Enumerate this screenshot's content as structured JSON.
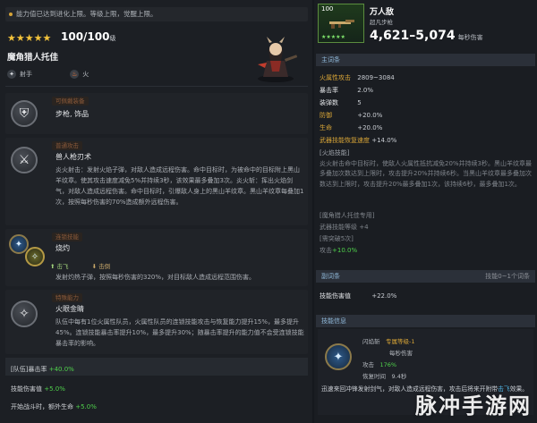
{
  "top_note": "能力值已达到进化上限。等级上限，觉醒上限。",
  "hero": {
    "stars": "★★★★★",
    "level": "100/100",
    "level_suffix": "级",
    "name": "魔角猎人托佳",
    "tags": [
      {
        "icon": "shooter-icon",
        "label": "射手"
      },
      {
        "icon": "fire-icon",
        "label": "火"
      }
    ]
  },
  "skills": [
    {
      "category": "可佩戴装备",
      "title": "步枪, 饰品",
      "text": ""
    },
    {
      "category": "普通攻击",
      "title": "兽人枪刃术",
      "text": "炎火射击：发射火焰子弹，对敌人造成远程伤害。命中目标时，为被命中的目标附上黑山羊纹章。使其攻击速度减免5%并持续3秒，该效果最多叠加3次。炎火斩：挥出火焰剑气，对敌人造成远程伤害。命中目标时，引爆敌人身上的黑山羊纹章。黑山羊纹章每叠加1次，按照每秒伤害的70%造成额外远程伤害。"
    },
    {
      "category": "连锁技能",
      "title": "烧灼",
      "text": "发射灼热子弹，按照每秒伤害的320%，对目标敌人造成远程范围伤害。",
      "sub_tags": [
        "击飞",
        "击倒"
      ]
    },
    {
      "category": "特殊能力",
      "title": "火眼金睛",
      "text": "队伍中每有1位火属性队员，火属性队员的连锁技能攻击与恢复能力提升15%，最多提升45%。连锁技能暴击率提升10%，最多提升30%；随暴击率提升的能力值不会受连锁技能暴击率的影响。"
    }
  ],
  "team": {
    "row1_label": "[队伍]暴击率",
    "row1_value": "+40.0%",
    "row2_label": "技能伤害值",
    "row2_value": "+5.0%",
    "row3_label": "开始战斗时，额外生命",
    "row3_value": "+5.0%"
  },
  "weapon": {
    "level": "100",
    "stars": "★★★★★",
    "name": "万人敌",
    "sub": "超凡步枪",
    "damage": "4,621–5,074",
    "damage_suffix": "每秒伤害"
  },
  "main_options": {
    "header": "主词条",
    "stats": [
      {
        "key": "火属性攻击",
        "value": "2809~3084",
        "style": "k"
      },
      {
        "key": "暴击率",
        "value": "2.0%",
        "style": "kw"
      },
      {
        "key": "装弹数",
        "value": "5",
        "style": "kw"
      },
      {
        "key": "防御",
        "value": "+20.0%",
        "style": "k"
      },
      {
        "key": "生命",
        "value": "+20.0%",
        "style": "k"
      },
      {
        "key": "武器技能恢复速度",
        "value": "+14.0%",
        "style": "k"
      }
    ],
    "note_tag": "[火焰技能]",
    "note_text": "炎火射击命中目标时，使敌人火属性抵抗减免20%并持续3秒。黑山羊纹章最多叠加次数达到上限时，攻击提升20%并持续6秒。当黑山羊纹章最多叠加次数达到上限时，攻击提升20%最多叠加1次，该持续6秒，最多叠加1次。",
    "exclusive_tag": "[魔角猎人托佳专用]",
    "exclusive_line": "武器技能等级 +4",
    "exclusive_tag2": "[需突破5次]",
    "exclusive_line2_key": "攻击",
    "exclusive_line2_value": "+10.0%"
  },
  "sub_options": {
    "header": "副词条",
    "header_right": "技能0~1个词条",
    "stat_key": "技能伤害值",
    "stat_value": "+22.0%"
  },
  "weapon_skill": {
    "header": "技能信息",
    "name_label": "闪焰斩",
    "level_label": "专属等级",
    "level_value": "1",
    "dps_label": "每秒伤害",
    "dps_prefix": "攻击",
    "dps_value": "176%",
    "cooldown_label": "恢复时间",
    "cooldown_value": "9.4秒",
    "desc": "迅速来回冲锋发射剑气，对敌人造成远程伤害，攻击后将来开附带",
    "desc_status": "击飞",
    "desc_end": "效果。"
  },
  "watermark": "脉冲手游网"
}
